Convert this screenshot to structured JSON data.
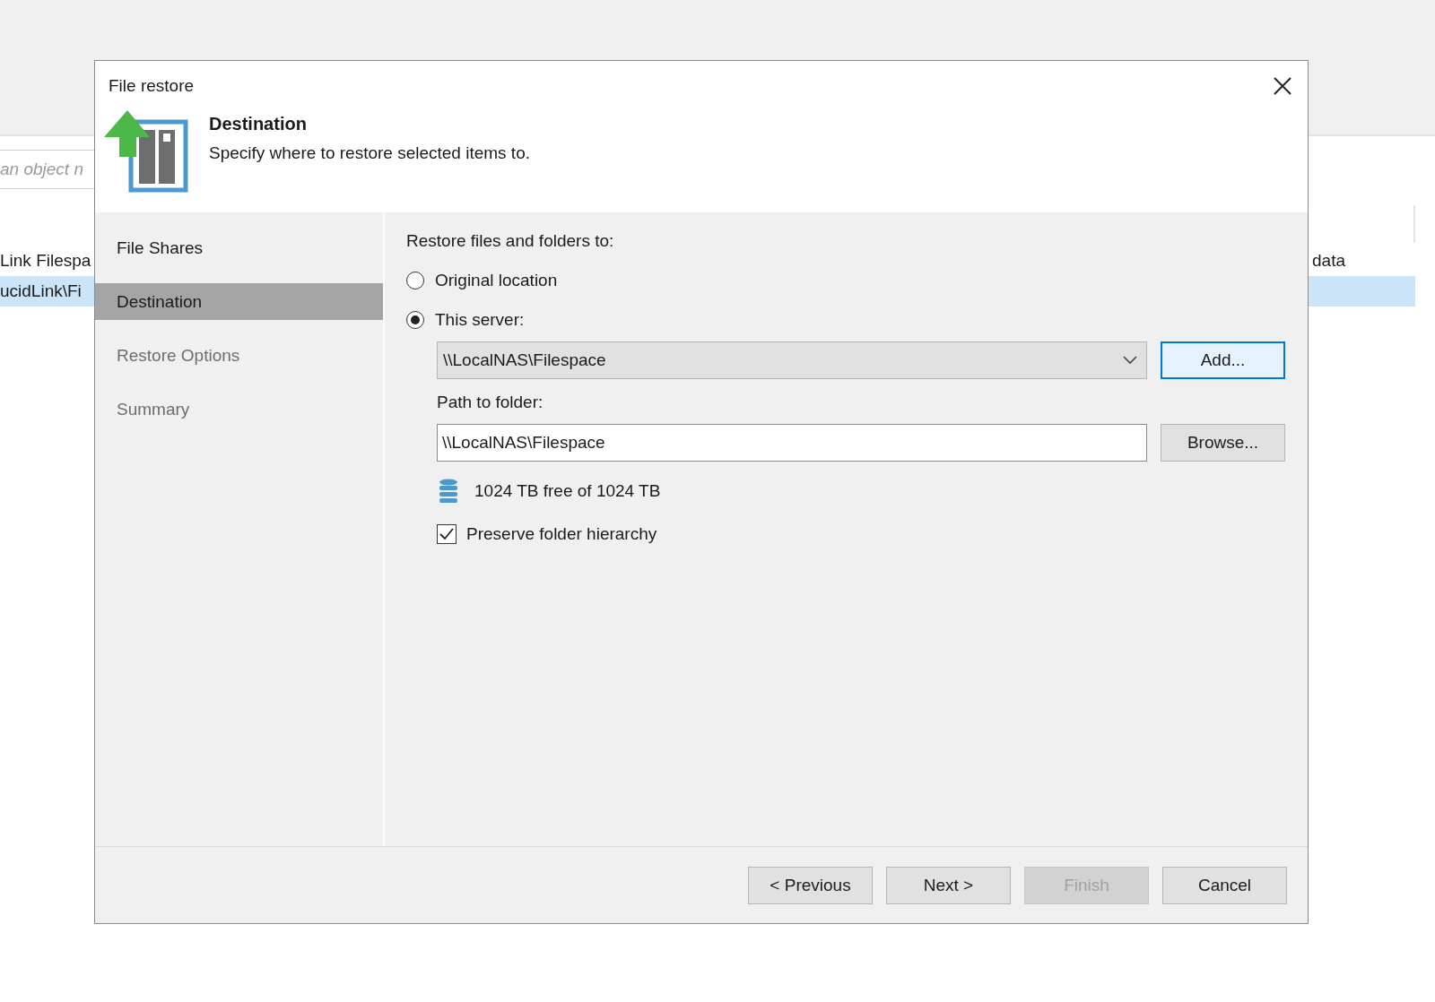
{
  "background_app": {
    "search": {
      "placeholder": "an object n"
    },
    "rows": [
      {
        "column_1": "Link Filespa",
        "column_2": "data",
        "selected": false
      },
      {
        "column_1": "ucidLink\\Fi",
        "selected": true
      }
    ]
  },
  "dialog": {
    "title": "File restore",
    "header": {
      "title": "Destination",
      "subtitle": "Specify where to restore selected items to."
    },
    "steps": [
      {
        "label": "File Shares",
        "selected": false,
        "disabled": false
      },
      {
        "label": "Destination",
        "selected": true,
        "disabled": false
      },
      {
        "label": "Restore Options",
        "selected": false,
        "disabled": true
      },
      {
        "label": "Summary",
        "selected": false,
        "disabled": true
      }
    ],
    "content": {
      "heading": "Restore files and folders to:",
      "options": [
        {
          "label": "Original location",
          "selected": false
        },
        {
          "label": "This server:",
          "selected": true
        }
      ],
      "server_dropdown": {
        "value": "\\\\LocalNAS\\Filespace"
      },
      "add_button": "Add...",
      "path_label": "Path to folder:",
      "path_field": {
        "value": "\\\\LocalNAS\\Filespace"
      },
      "browse_button": "Browse...",
      "storage_info": "1024 TB free of 1024 TB",
      "preserve": {
        "label": "Preserve folder hierarchy",
        "checked": true
      }
    },
    "buttons": [
      {
        "label": "< Previous",
        "disabled": false
      },
      {
        "label": "Next >",
        "disabled": false
      },
      {
        "label": "Finish",
        "disabled": true
      },
      {
        "label": "Cancel",
        "disabled": false
      }
    ]
  }
}
